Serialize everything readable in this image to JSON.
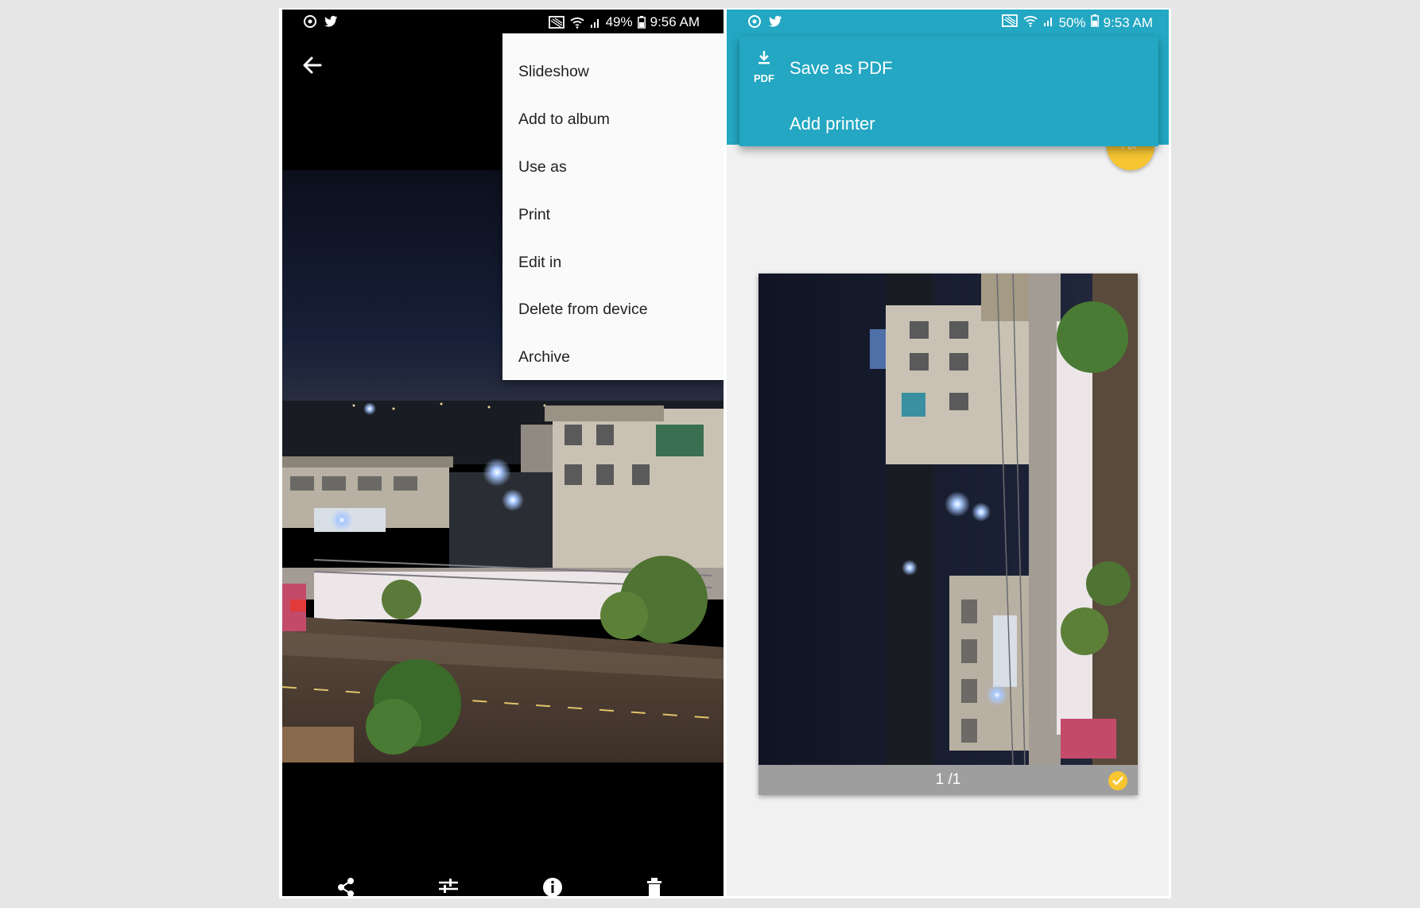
{
  "left_phone": {
    "status_bar": {
      "battery": "49%",
      "time": "9:56 AM"
    },
    "menu": {
      "items": [
        "Slideshow",
        "Add to album",
        "Use as",
        "Print",
        "Edit in",
        "Delete from device",
        "Archive"
      ]
    },
    "icons": [
      "camera-sync-icon",
      "twitter-icon",
      "cast-icon",
      "wifi-icon",
      "signal-icon",
      "battery-icon",
      "back-arrow-icon",
      "share-icon",
      "edit-sliders-icon",
      "info-icon",
      "delete-icon"
    ]
  },
  "right_phone": {
    "status_bar": {
      "battery": "50%",
      "time": "9:53 AM"
    },
    "dropdown": {
      "save_pdf_label": "Save as PDF",
      "add_printer_label": "Add printer",
      "pdf_icon_text": "PDF"
    },
    "fab_text": "PDF",
    "preview": {
      "page_count": "1 /1"
    },
    "colors": {
      "accent": "#23a7c2",
      "fab": "#f7c531"
    }
  }
}
